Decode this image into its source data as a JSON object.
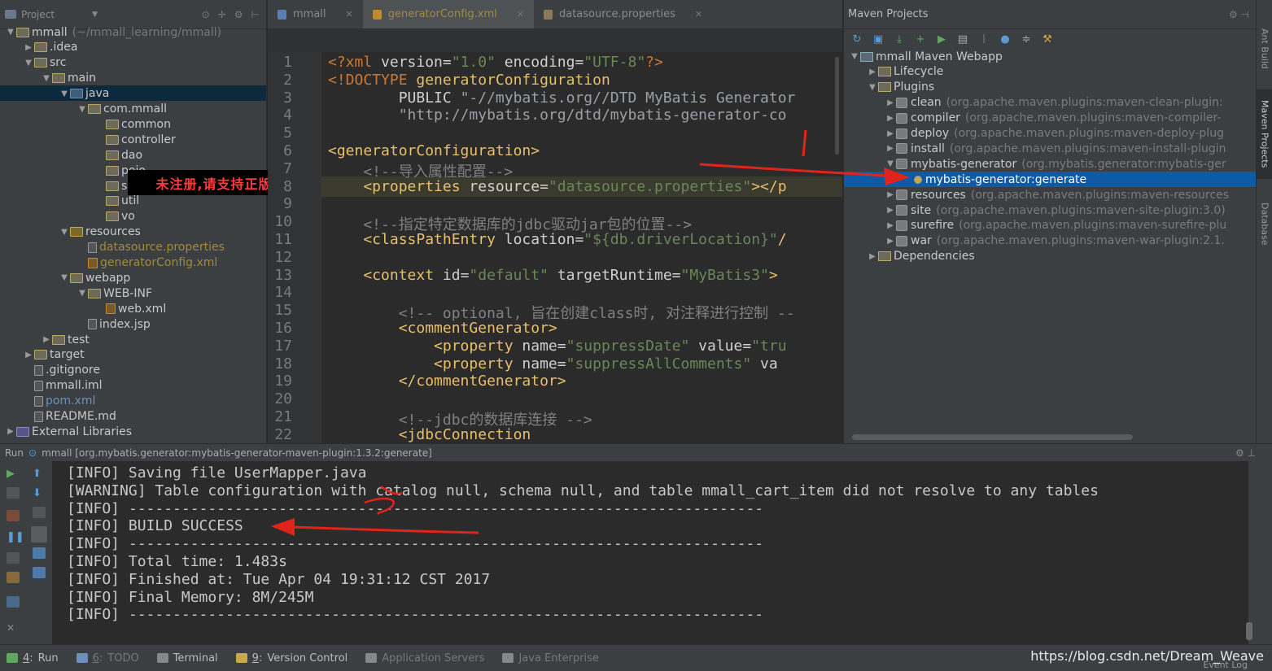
{
  "project_panel": {
    "title": "Project",
    "tree": [
      {
        "label": "mmall",
        "suffix": "(~/mmall_learning/mmall)",
        "indent": 0,
        "icon": "module-folder",
        "expanded": true
      },
      {
        "label": ".idea",
        "indent": 1,
        "icon": "folder",
        "expanded": false
      },
      {
        "label": "src",
        "indent": 1,
        "icon": "folder",
        "expanded": true
      },
      {
        "label": "main",
        "indent": 2,
        "icon": "folder",
        "expanded": true
      },
      {
        "label": "java",
        "indent": 3,
        "icon": "source-folder",
        "expanded": true,
        "selected": true
      },
      {
        "label": "com.mmall",
        "indent": 4,
        "icon": "package",
        "expanded": true
      },
      {
        "label": "common",
        "indent": 5,
        "icon": "package"
      },
      {
        "label": "controller",
        "indent": 5,
        "icon": "package"
      },
      {
        "label": "dao",
        "indent": 5,
        "icon": "package"
      },
      {
        "label": "pojo",
        "indent": 5,
        "icon": "package"
      },
      {
        "label": "service",
        "indent": 5,
        "icon": "package"
      },
      {
        "label": "util",
        "indent": 5,
        "icon": "package"
      },
      {
        "label": "vo",
        "indent": 5,
        "icon": "package"
      },
      {
        "label": "resources",
        "indent": 3,
        "icon": "resource-folder",
        "expanded": true
      },
      {
        "label": "datasource.properties",
        "indent": 4,
        "icon": "properties-file",
        "style": "gold"
      },
      {
        "label": "generatorConfig.xml",
        "indent": 4,
        "icon": "xml-file",
        "style": "gold"
      },
      {
        "label": "webapp",
        "indent": 3,
        "icon": "web-folder",
        "expanded": true
      },
      {
        "label": "WEB-INF",
        "indent": 4,
        "icon": "folder",
        "expanded": true
      },
      {
        "label": "web.xml",
        "indent": 5,
        "icon": "xml-file"
      },
      {
        "label": "index.jsp",
        "indent": 4,
        "icon": "jsp-file"
      },
      {
        "label": "test",
        "indent": 2,
        "icon": "folder",
        "expanded": false
      },
      {
        "label": "target",
        "indent": 1,
        "icon": "folder",
        "expanded": false
      },
      {
        "label": ".gitignore",
        "indent": 1,
        "icon": "file"
      },
      {
        "label": "mmall.iml",
        "indent": 1,
        "icon": "file"
      },
      {
        "label": "pom.xml",
        "indent": 1,
        "icon": "maven-file",
        "style": "blueish"
      },
      {
        "label": "README.md",
        "indent": 1,
        "icon": "file"
      },
      {
        "label": "External Libraries",
        "indent": 0,
        "icon": "library",
        "expanded": false
      }
    ]
  },
  "watermark": "未注册,请支持正版",
  "editor": {
    "tabs": [
      {
        "label": "mmall",
        "icon": "maven-file-icon",
        "active": false
      },
      {
        "label": "generatorConfig.xml",
        "icon": "xml-file-icon",
        "active": true
      },
      {
        "label": "datasource.properties",
        "icon": "properties-file-icon",
        "active": false
      }
    ],
    "line_numbers": [
      "1",
      "2",
      "3",
      "4",
      "5",
      "6",
      "7",
      "8",
      "9",
      "10",
      "11",
      "12",
      "13",
      "14",
      "15",
      "16",
      "17",
      "18",
      "19",
      "20",
      "21",
      "22"
    ],
    "lines": [
      {
        "n": 0,
        "parts": [
          [
            "c-doct",
            "<?xml "
          ],
          [
            "c-attr",
            "version="
          ],
          [
            "c-str",
            "\"1.0\""
          ],
          [
            "c-attr",
            " encoding="
          ],
          [
            "c-str",
            "\"UTF-8\""
          ],
          [
            "c-doct",
            "?>"
          ]
        ]
      },
      {
        "n": 1,
        "parts": [
          [
            "c-doct",
            "<!DOCTYPE "
          ],
          [
            "c-name",
            "generatorConfiguration"
          ]
        ]
      },
      {
        "n": 2,
        "parts": [
          [
            "c-attr",
            "        PUBLIC "
          ],
          [
            "c-url",
            "\"-//mybatis.org//DTD MyBatis Generator"
          ]
        ]
      },
      {
        "n": 3,
        "parts": [
          [
            "c-url",
            "        \"http://mybatis.org/dtd/mybatis-generator-co"
          ]
        ]
      },
      {
        "n": 4,
        "parts": []
      },
      {
        "n": 5,
        "parts": [
          [
            "c-tag",
            "<generatorConfiguration>"
          ]
        ]
      },
      {
        "n": 6,
        "parts": [
          [
            "c-cmt",
            "    <!--导入属性配置-->"
          ]
        ]
      },
      {
        "n": 7,
        "parts": [
          [
            "c-tag",
            "    <properties "
          ],
          [
            "c-attr",
            "resource="
          ],
          [
            "c-str",
            "\"datasource.properties\""
          ],
          [
            "c-tag",
            "></p"
          ]
        ]
      },
      {
        "n": 8,
        "parts": []
      },
      {
        "n": 9,
        "parts": [
          [
            "c-cmt",
            "    <!--指定特定数据库的jdbc驱动jar包的位置-->"
          ]
        ]
      },
      {
        "n": 10,
        "parts": [
          [
            "c-tag",
            "    <classPathEntry "
          ],
          [
            "c-attr",
            "location="
          ],
          [
            "c-str",
            "\"${db.driverLocation}\""
          ],
          [
            "c-tag",
            "/"
          ]
        ]
      },
      {
        "n": 11,
        "parts": []
      },
      {
        "n": 12,
        "parts": [
          [
            "c-tag",
            "    <context "
          ],
          [
            "c-attr",
            "id="
          ],
          [
            "c-str",
            "\"default\""
          ],
          [
            "c-attr",
            " targetRuntime="
          ],
          [
            "c-str",
            "\"MyBatis3\""
          ],
          [
            "c-tag",
            ">"
          ]
        ]
      },
      {
        "n": 13,
        "parts": []
      },
      {
        "n": 14,
        "parts": [
          [
            "c-cmt",
            "        <!-- optional, 旨在创建class时, 对注释进行控制 --"
          ]
        ]
      },
      {
        "n": 15,
        "parts": [
          [
            "c-tag",
            "        <commentGenerator>"
          ]
        ]
      },
      {
        "n": 16,
        "parts": [
          [
            "c-tag",
            "            <property "
          ],
          [
            "c-attr",
            "name="
          ],
          [
            "c-str",
            "\"suppressDate\""
          ],
          [
            "c-attr",
            " value="
          ],
          [
            "c-str",
            "\"tru"
          ]
        ]
      },
      {
        "n": 17,
        "parts": [
          [
            "c-tag",
            "            <property "
          ],
          [
            "c-attr",
            "name="
          ],
          [
            "c-str",
            "\"suppressAllComments\""
          ],
          [
            "c-attr",
            " va"
          ]
        ]
      },
      {
        "n": 18,
        "parts": [
          [
            "c-tag",
            "        </commentGenerator>"
          ]
        ]
      },
      {
        "n": 19,
        "parts": []
      },
      {
        "n": 20,
        "parts": [
          [
            "c-cmt",
            "        <!--jdbc的数据库连接 -->"
          ]
        ]
      },
      {
        "n": 21,
        "parts": [
          [
            "c-tag",
            "        <jdbcConnection"
          ]
        ]
      }
    ]
  },
  "maven_panel": {
    "title": "Maven Projects",
    "tree": [
      {
        "label": "mmall Maven Webapp",
        "indent": 0,
        "icon": "maven-project",
        "expanded": true
      },
      {
        "label": "Lifecycle",
        "indent": 1,
        "icon": "folder",
        "expanded": false
      },
      {
        "label": "Plugins",
        "indent": 1,
        "icon": "folder",
        "expanded": true
      },
      {
        "label": "clean",
        "detail": "(org.apache.maven.plugins:maven-clean-plugin:",
        "indent": 2,
        "icon": "plugin"
      },
      {
        "label": "compiler",
        "detail": "(org.apache.maven.plugins:maven-compiler-",
        "indent": 2,
        "icon": "plugin"
      },
      {
        "label": "deploy",
        "detail": "(org.apache.maven.plugins:maven-deploy-plug",
        "indent": 2,
        "icon": "plugin"
      },
      {
        "label": "install",
        "detail": "(org.apache.maven.plugins:maven-install-plugin",
        "indent": 2,
        "icon": "plugin"
      },
      {
        "label": "mybatis-generator",
        "detail": "(org.mybatis.generator:mybatis-ger",
        "indent": 2,
        "icon": "plugin",
        "expanded": true
      },
      {
        "label": "mybatis-generator:generate",
        "indent": 3,
        "icon": "goal",
        "selected": true
      },
      {
        "label": "resources",
        "detail": "(org.apache.maven.plugins:maven-resources",
        "indent": 2,
        "icon": "plugin"
      },
      {
        "label": "site",
        "detail": "(org.apache.maven.plugins:maven-site-plugin:3.0)",
        "indent": 2,
        "icon": "plugin"
      },
      {
        "label": "surefire",
        "detail": "(org.apache.maven.plugins:maven-surefire-plu",
        "indent": 2,
        "icon": "plugin"
      },
      {
        "label": "war",
        "detail": "(org.apache.maven.plugins:maven-war-plugin:2.1.",
        "indent": 2,
        "icon": "plugin"
      },
      {
        "label": "Dependencies",
        "indent": 1,
        "icon": "folder",
        "expanded": false
      }
    ]
  },
  "side_tabs": [
    "Ant Build",
    "Maven Projects",
    "Database"
  ],
  "run_panel": {
    "title": "Run",
    "config": "mmall [org.mybatis.generator:mybatis-generator-maven-plugin:1.3.2:generate]",
    "console": [
      "[INFO] Saving file UserMapper.java",
      "[WARNING] Table configuration with catalog null, schema null, and table mmall_cart_item did not resolve to any tables",
      "[INFO] ------------------------------------------------------------------------",
      "[INFO] BUILD SUCCESS",
      "[INFO] ------------------------------------------------------------------------",
      "[INFO] Total time: 1.483s",
      "[INFO] Finished at: Tue Apr 04 19:31:12 CST 2017",
      "[INFO] Final Memory: 8M/245M",
      "[INFO] ------------------------------------------------------------------------"
    ]
  },
  "status_bar": {
    "items": [
      {
        "key": "4",
        "label": "Run",
        "active": true
      },
      {
        "key": "6",
        "label": "TODO",
        "active": false
      },
      {
        "key": "",
        "label": "Terminal",
        "active": true
      },
      {
        "key": "9",
        "label": "Version Control",
        "active": true
      },
      {
        "key": "",
        "label": "Application Servers",
        "active": false
      },
      {
        "key": "",
        "label": "Java Enterprise",
        "active": false
      }
    ],
    "event_log": "Event Log"
  },
  "source_url": "https://blog.csdn.net/Dream_Weave",
  "colors": {
    "annotation_red": "#e0241b",
    "selection_blue": "#0d5aa7",
    "tag_yellow": "#e8bf6a",
    "string_green": "#6a8759"
  }
}
